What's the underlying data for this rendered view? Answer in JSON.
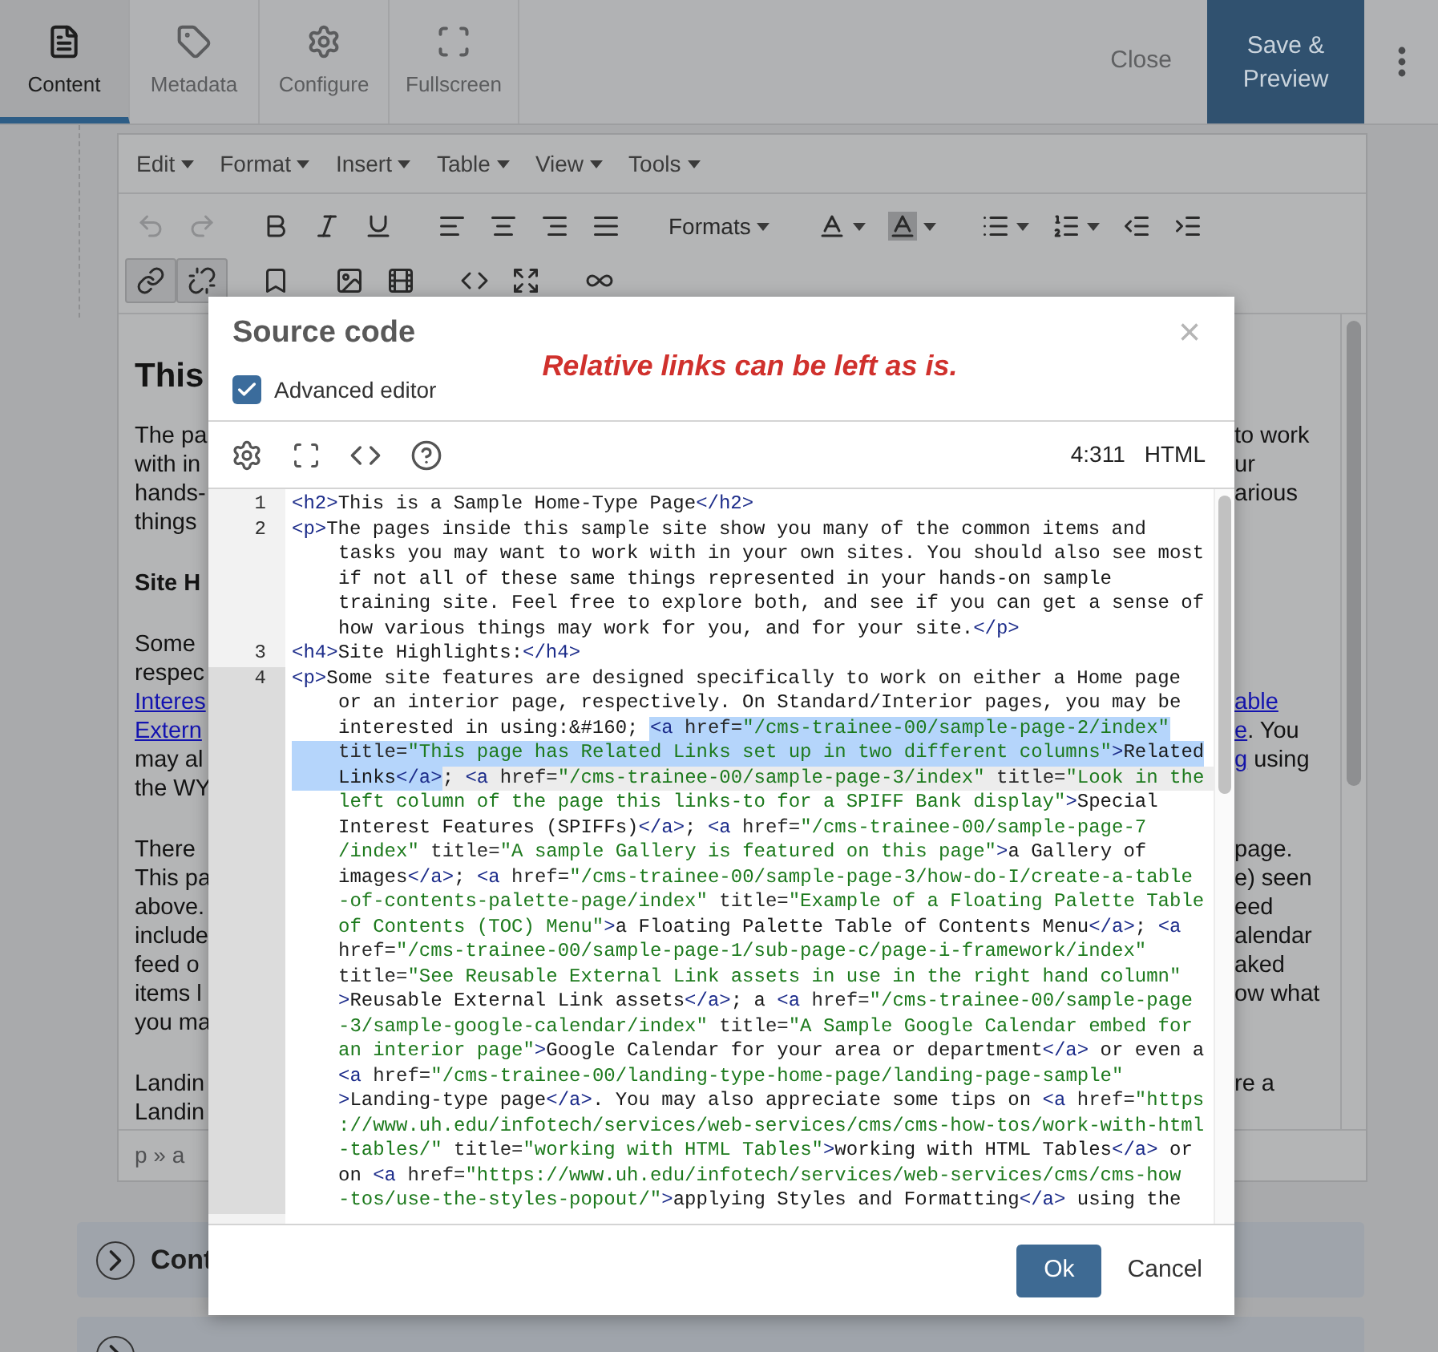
{
  "top_bar": {
    "tabs": [
      {
        "label": "Content",
        "kind": "document",
        "selected": true
      },
      {
        "label": "Metadata",
        "kind": "tag",
        "selected": false
      },
      {
        "label": "Configure",
        "kind": "gear",
        "selected": false
      },
      {
        "label": "Fullscreen",
        "kind": "expand",
        "selected": false
      }
    ],
    "close_label": "Close",
    "save_label": "Save & Preview"
  },
  "editor": {
    "menus": [
      "Edit",
      "Format",
      "Insert",
      "Table",
      "View",
      "Tools"
    ],
    "toolbar_rows": [
      {
        "items": [
          {
            "kind": "undo",
            "disabled": true,
            "pressed": false
          },
          {
            "kind": "redo",
            "disabled": true,
            "pressed": false
          },
          {
            "kind": "bold",
            "disabled": false,
            "pressed": false
          },
          {
            "kind": "italic",
            "disabled": false,
            "pressed": false
          },
          {
            "kind": "underline",
            "disabled": false,
            "pressed": false
          },
          {
            "kind": "align_left",
            "disabled": false,
            "pressed": false
          },
          {
            "kind": "align_center",
            "disabled": false,
            "pressed": false
          },
          {
            "kind": "align_right",
            "disabled": false,
            "pressed": false
          },
          {
            "kind": "align_justify",
            "disabled": false,
            "pressed": false
          },
          {
            "kind": "formats",
            "label": "Formats",
            "disabled": false,
            "pressed": false
          },
          {
            "kind": "font_color",
            "disabled": false,
            "pressed": false
          },
          {
            "kind": "background_color",
            "disabled": false,
            "pressed": false
          },
          {
            "kind": "bullet_list",
            "disabled": false,
            "pressed": false
          },
          {
            "kind": "numbered_list",
            "disabled": false,
            "pressed": false
          },
          {
            "kind": "outdent",
            "disabled": false,
            "pressed": false
          },
          {
            "kind": "indent",
            "disabled": false,
            "pressed": false
          }
        ]
      },
      {
        "items": [
          {
            "kind": "link",
            "disabled": false,
            "pressed": true
          },
          {
            "kind": "unlink",
            "disabled": false,
            "pressed": true
          },
          {
            "kind": "bookmark",
            "disabled": false,
            "pressed": false
          },
          {
            "kind": "image",
            "disabled": false,
            "pressed": false
          },
          {
            "kind": "media",
            "disabled": false,
            "pressed": false
          },
          {
            "kind": "code",
            "disabled": false,
            "pressed": false
          },
          {
            "kind": "fullscreen",
            "disabled": false,
            "pressed": false
          },
          {
            "kind": "template",
            "disabled": false,
            "pressed": false
          }
        ]
      }
    ],
    "content": [
      {
        "kind": "heading",
        "lines": [
          {
            "left": [
              {
                "text": "This",
                "link": false
              }
            ]
          }
        ]
      },
      {
        "kind": "paragraph",
        "lines": [
          {
            "left": [
              {
                "text": "The pa",
                "link": false
              }
            ],
            "right": [
              {
                "text": "to work",
                "link": false
              }
            ]
          },
          {
            "left": [
              {
                "text": "with in",
                "link": false
              }
            ],
            "right": [
              {
                "text": "ur",
                "link": false
              }
            ]
          },
          {
            "left": [
              {
                "text": "hands-",
                "link": false
              }
            ],
            "right": [
              {
                "text": "arious",
                "link": false
              }
            ]
          },
          {
            "left": [
              {
                "text": "things",
                "link": false
              }
            ]
          }
        ]
      },
      {
        "kind": "subheading",
        "lines": [
          {
            "left": [
              {
                "text": "Site H",
                "link": false
              }
            ]
          }
        ]
      },
      {
        "kind": "paragraph",
        "lines": [
          {
            "left": [
              {
                "text": "Some",
                "link": false
              }
            ]
          },
          {
            "left": [
              {
                "text": "respec",
                "link": false
              }
            ]
          },
          {
            "left": [
              {
                "text": "Interes",
                "link": true
              }
            ],
            "right": [
              {
                "text": "able",
                "link": true
              }
            ]
          },
          {
            "left": [
              {
                "text": "Extern",
                "link": true
              }
            ],
            "right": [
              {
                "text": "e",
                "link": true
              },
              {
                "text": ". You",
                "link": false
              }
            ]
          },
          {
            "left": [
              {
                "text": "may al",
                "link": false
              }
            ],
            "right": [
              {
                "text": "g",
                "link": true
              },
              {
                "text": " using",
                "link": false
              }
            ]
          },
          {
            "left": [
              {
                "text": "the WY",
                "link": false
              }
            ]
          }
        ]
      },
      {
        "kind": "paragraph",
        "lines": [
          {
            "left": [
              {
                "text": "There",
                "link": false
              }
            ],
            "right": [
              {
                "text": "page.",
                "link": false
              }
            ]
          },
          {
            "left": [
              {
                "text": "This pa",
                "link": false
              }
            ],
            "right": [
              {
                "text": "e) seen",
                "link": false
              }
            ]
          },
          {
            "left": [
              {
                "text": "above.",
                "link": false
              }
            ],
            "right": [
              {
                "text": "eed",
                "link": false
              }
            ]
          },
          {
            "left": [
              {
                "text": "include",
                "link": false
              }
            ],
            "right": [
              {
                "text": "alendar",
                "link": false
              }
            ]
          },
          {
            "left": [
              {
                "text": "feed o",
                "link": false
              }
            ],
            "right": [
              {
                "text": "aked",
                "link": false
              }
            ]
          },
          {
            "left": [
              {
                "text": "items l",
                "link": false
              }
            ],
            "right": [
              {
                "text": "ow what",
                "link": false
              }
            ]
          },
          {
            "left": [
              {
                "text": "you ma",
                "link": false
              }
            ]
          }
        ]
      },
      {
        "kind": "paragraph",
        "lines": [
          {
            "left": [
              {
                "text": "Landin",
                "link": false
              }
            ],
            "right": [
              {
                "text": "re a",
                "link": false
              }
            ]
          },
          {
            "left": [
              {
                "text": "Landin",
                "link": false
              }
            ]
          }
        ]
      }
    ],
    "status_path": "p » a"
  },
  "sections": [
    {
      "title": "Cont"
    }
  ],
  "dialog": {
    "title": "Source code",
    "close": "×",
    "advanced_editor": {
      "label": "Advanced editor",
      "checked": true
    },
    "note": "Relative links can be left as is.",
    "cursor_position": "4:311",
    "mode": "HTML",
    "code_lines": [
      {
        "number": "1",
        "active": false,
        "rows": [
          [
            {
              "kind": "tag",
              "text": "<h2>",
              "selected": false
            },
            {
              "kind": "text",
              "text": "This is a Sample Home-Type Page",
              "selected": false
            },
            {
              "kind": "tag",
              "text": "</h2>",
              "selected": false
            }
          ]
        ]
      },
      {
        "number": "2",
        "active": false,
        "rows": [
          [
            {
              "kind": "tag",
              "text": "<p>",
              "selected": false
            },
            {
              "kind": "text",
              "text": "The pages inside this sample site show you many of the common items and",
              "selected": false
            }
          ],
          [
            {
              "kind": "text",
              "text": "tasks you may want to work with in your own sites. You should also see most",
              "selected": false
            }
          ],
          [
            {
              "kind": "text",
              "text": "if not all of these same things represented in your hands-on sample",
              "selected": false
            }
          ],
          [
            {
              "kind": "text",
              "text": "training site. Feel free to explore both, and see if you can get a sense of",
              "selected": false
            }
          ],
          [
            {
              "kind": "text",
              "text": "how various things may work for you, and for your site.",
              "selected": false
            },
            {
              "kind": "tag",
              "text": "</p>",
              "selected": false
            }
          ]
        ]
      },
      {
        "number": "3",
        "active": false,
        "rows": [
          [
            {
              "kind": "tag",
              "text": "<h4>",
              "selected": false
            },
            {
              "kind": "text",
              "text": "Site Highlights:",
              "selected": false
            },
            {
              "kind": "tag",
              "text": "</h4>",
              "selected": false
            }
          ]
        ]
      },
      {
        "number": "4",
        "active": true,
        "rows": [
          [
            {
              "kind": "tag",
              "text": "<p>",
              "selected": false
            },
            {
              "kind": "text",
              "text": "Some site features are designed specifically to work on either a Home page",
              "selected": false
            }
          ],
          [
            {
              "kind": "text",
              "text": "or an interior page, respectively. On Standard/Interior pages, you may be",
              "selected": false
            }
          ],
          [
            {
              "kind": "text",
              "text": "interested in using:&#160; ",
              "selected": false
            },
            {
              "kind": "tag",
              "text": "<a",
              "selected": true
            },
            {
              "kind": "attr",
              "text": " href=",
              "selected": true
            },
            {
              "kind": "string",
              "text": "\"/cms-trainee-00/sample-page-2/index\"",
              "selected": true
            }
          ],
          [
            {
              "kind": "attr",
              "text": "title=",
              "selected": true
            },
            {
              "kind": "string",
              "text": "\"This page has Related Links set up in two different columns\"",
              "selected": true
            },
            {
              "kind": "tag",
              "text": ">",
              "selected": true
            },
            {
              "kind": "text",
              "text": "Related",
              "selected": true
            }
          ],
          [
            {
              "kind": "text",
              "text": "Links",
              "selected": true
            },
            {
              "kind": "tag",
              "text": "</a>",
              "selected": true
            },
            {
              "kind": "text",
              "text": "; ",
              "selected": false
            },
            {
              "kind": "tag",
              "text": "<a",
              "selected": false
            },
            {
              "kind": "attr",
              "text": " href=",
              "selected": false
            },
            {
              "kind": "string",
              "text": "\"/cms-trainee-00/sample-page-3/index\"",
              "selected": false
            },
            {
              "kind": "attr",
              "text": " title=",
              "selected": false
            },
            {
              "kind": "string",
              "text": "\"Look in the",
              "selected": false
            }
          ],
          [
            {
              "kind": "string",
              "text": "left column of the page this links-to for a SPIFF Bank display\"",
              "selected": false
            },
            {
              "kind": "tag",
              "text": ">",
              "selected": false
            },
            {
              "kind": "text",
              "text": "Special",
              "selected": false
            }
          ],
          [
            {
              "kind": "text",
              "text": "Interest Features (SPIFFs)",
              "selected": false
            },
            {
              "kind": "tag",
              "text": "</a>",
              "selected": false
            },
            {
              "kind": "text",
              "text": "; ",
              "selected": false
            },
            {
              "kind": "tag",
              "text": "<a",
              "selected": false
            },
            {
              "kind": "attr",
              "text": " href=",
              "selected": false
            },
            {
              "kind": "string",
              "text": "\"/cms-trainee-00/sample-page-7",
              "selected": false
            }
          ],
          [
            {
              "kind": "string",
              "text": "/index\"",
              "selected": false
            },
            {
              "kind": "attr",
              "text": " title=",
              "selected": false
            },
            {
              "kind": "string",
              "text": "\"A sample Gallery is featured on this page\"",
              "selected": false
            },
            {
              "kind": "tag",
              "text": ">",
              "selected": false
            },
            {
              "kind": "text",
              "text": "a Gallery of",
              "selected": false
            }
          ],
          [
            {
              "kind": "text",
              "text": "images",
              "selected": false
            },
            {
              "kind": "tag",
              "text": "</a>",
              "selected": false
            },
            {
              "kind": "text",
              "text": "; ",
              "selected": false
            },
            {
              "kind": "tag",
              "text": "<a",
              "selected": false
            },
            {
              "kind": "attr",
              "text": " href=",
              "selected": false
            },
            {
              "kind": "string",
              "text": "\"/cms-trainee-00/sample-page-3/how-do-I/create-a-table",
              "selected": false
            }
          ],
          [
            {
              "kind": "string",
              "text": "-of-contents-palette-page/index\"",
              "selected": false
            },
            {
              "kind": "attr",
              "text": " title=",
              "selected": false
            },
            {
              "kind": "string",
              "text": "\"Example of a Floating Palette Table",
              "selected": false
            }
          ],
          [
            {
              "kind": "string",
              "text": "of Contents (TOC) Menu\"",
              "selected": false
            },
            {
              "kind": "tag",
              "text": ">",
              "selected": false
            },
            {
              "kind": "text",
              "text": "a Floating Palette Table of Contents Menu",
              "selected": false
            },
            {
              "kind": "tag",
              "text": "</a>",
              "selected": false
            },
            {
              "kind": "text",
              "text": "; ",
              "selected": false
            },
            {
              "kind": "tag",
              "text": "<a",
              "selected": false
            }
          ],
          [
            {
              "kind": "attr",
              "text": "href=",
              "selected": false
            },
            {
              "kind": "string",
              "text": "\"/cms-trainee-00/sample-page-1/sub-page-c/page-i-framework/index\"",
              "selected": false
            }
          ],
          [
            {
              "kind": "attr",
              "text": "title=",
              "selected": false
            },
            {
              "kind": "string",
              "text": "\"See Reusable External Link assets in use in the right hand column\"",
              "selected": false
            }
          ],
          [
            {
              "kind": "tag",
              "text": ">",
              "selected": false
            },
            {
              "kind": "text",
              "text": "Reusable External Link assets",
              "selected": false
            },
            {
              "kind": "tag",
              "text": "</a>",
              "selected": false
            },
            {
              "kind": "text",
              "text": "; a ",
              "selected": false
            },
            {
              "kind": "tag",
              "text": "<a",
              "selected": false
            },
            {
              "kind": "attr",
              "text": " href=",
              "selected": false
            },
            {
              "kind": "string",
              "text": "\"/cms-trainee-00/sample-page",
              "selected": false
            }
          ],
          [
            {
              "kind": "string",
              "text": "-3/sample-google-calendar/index\"",
              "selected": false
            },
            {
              "kind": "attr",
              "text": " title=",
              "selected": false
            },
            {
              "kind": "string",
              "text": "\"A Sample Google Calendar embed for",
              "selected": false
            }
          ],
          [
            {
              "kind": "string",
              "text": "an interior page\"",
              "selected": false
            },
            {
              "kind": "tag",
              "text": ">",
              "selected": false
            },
            {
              "kind": "text",
              "text": "Google Calendar for your area or department",
              "selected": false
            },
            {
              "kind": "tag",
              "text": "</a>",
              "selected": false
            },
            {
              "kind": "text",
              "text": " or even a",
              "selected": false
            }
          ],
          [
            {
              "kind": "tag",
              "text": "<a",
              "selected": false
            },
            {
              "kind": "attr",
              "text": " href=",
              "selected": false
            },
            {
              "kind": "string",
              "text": "\"/cms-trainee-00/landing-type-home-page/landing-page-sample\"",
              "selected": false
            }
          ],
          [
            {
              "kind": "tag",
              "text": ">",
              "selected": false
            },
            {
              "kind": "text",
              "text": "Landing-type page",
              "selected": false
            },
            {
              "kind": "tag",
              "text": "</a>",
              "selected": false
            },
            {
              "kind": "text",
              "text": ". You may also appreciate some tips on ",
              "selected": false
            },
            {
              "kind": "tag",
              "text": "<a",
              "selected": false
            },
            {
              "kind": "attr",
              "text": " href=",
              "selected": false
            },
            {
              "kind": "string",
              "text": "\"https",
              "selected": false
            }
          ],
          [
            {
              "kind": "string",
              "text": "://www.uh.edu/infotech/services/web-services/cms/cms-how-tos/work-with-html",
              "selected": false
            }
          ],
          [
            {
              "kind": "string",
              "text": "-tables/\"",
              "selected": false
            },
            {
              "kind": "attr",
              "text": " title=",
              "selected": false
            },
            {
              "kind": "string",
              "text": "\"working with HTML Tables\"",
              "selected": false
            },
            {
              "kind": "tag",
              "text": ">",
              "selected": false
            },
            {
              "kind": "text",
              "text": "working with HTML Tables",
              "selected": false
            },
            {
              "kind": "tag",
              "text": "</a>",
              "selected": false
            },
            {
              "kind": "text",
              "text": " or",
              "selected": false
            }
          ],
          [
            {
              "kind": "text",
              "text": "on ",
              "selected": false
            },
            {
              "kind": "tag",
              "text": "<a",
              "selected": false
            },
            {
              "kind": "attr",
              "text": " href=",
              "selected": false
            },
            {
              "kind": "string",
              "text": "\"https://www.uh.edu/infotech/services/web-services/cms/cms-how",
              "selected": false
            }
          ],
          [
            {
              "kind": "string",
              "text": "-tos/use-the-styles-popout/\"",
              "selected": false
            },
            {
              "kind": "tag",
              "text": ">",
              "selected": false
            },
            {
              "kind": "text",
              "text": "applying Styles and Formatting",
              "selected": false
            },
            {
              "kind": "tag",
              "text": "</a>",
              "selected": false
            },
            {
              "kind": "text",
              "text": " using the",
              "selected": false
            }
          ]
        ]
      }
    ],
    "buttons": [
      {
        "label": "Ok",
        "kind": "primary"
      },
      {
        "label": "Cancel",
        "kind": "secondary"
      }
    ]
  }
}
